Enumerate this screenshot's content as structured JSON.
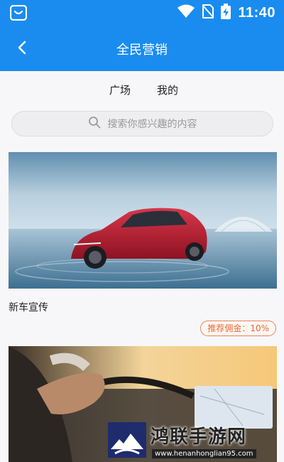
{
  "status_bar": {
    "time": "11:40"
  },
  "header": {
    "title": "全民营销"
  },
  "tabs": [
    {
      "label": "广场",
      "active": true
    },
    {
      "label": "我的",
      "active": false
    }
  ],
  "search": {
    "placeholder": "搜索你感兴趣的内容"
  },
  "cards": [
    {
      "title": "新车宣传",
      "commission": "推荐佣金：10%"
    }
  ],
  "watermark": {
    "name": "鸿联手游网",
    "url": "www.henanhonglian95.com"
  },
  "colors": {
    "primary": "#1a8cf0",
    "commission": "#e36a38"
  }
}
